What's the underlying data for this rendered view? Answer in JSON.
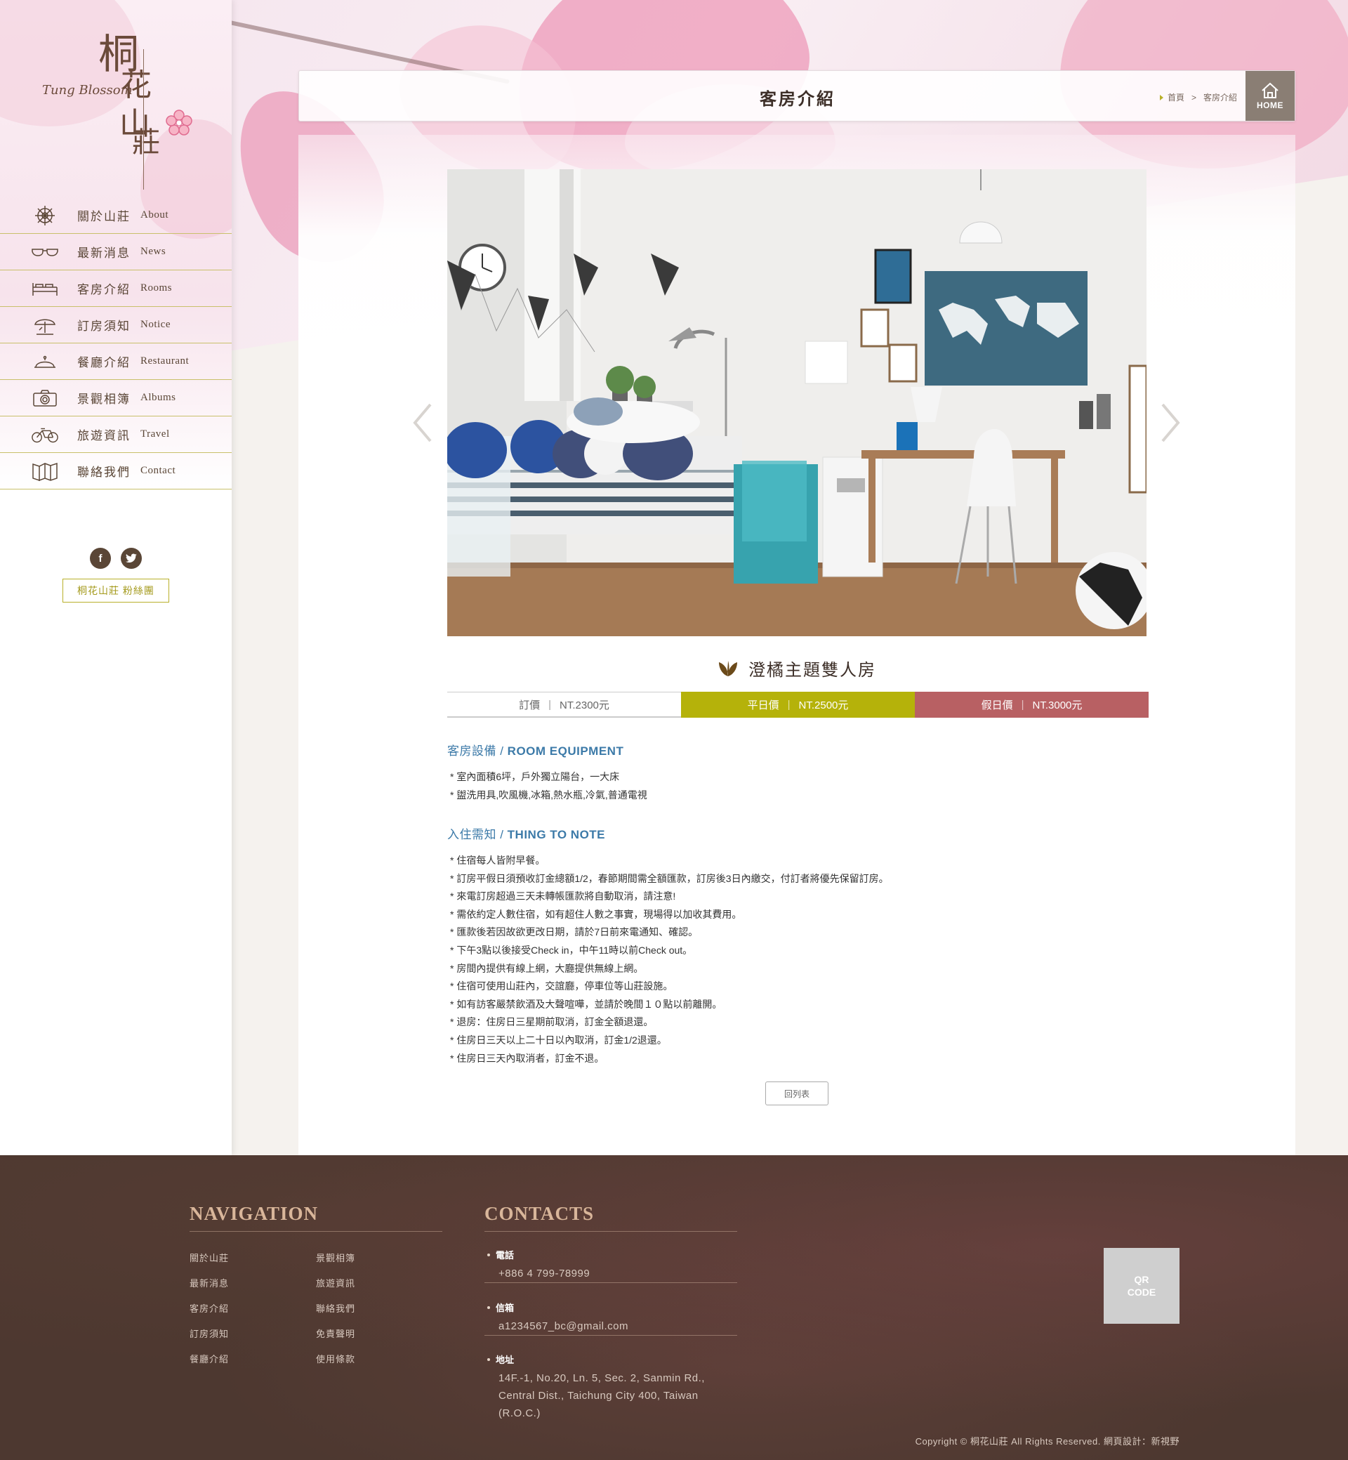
{
  "logo": {
    "zh_chars": [
      "桐",
      "花",
      "山",
      "莊"
    ],
    "en": "Tung Blossom"
  },
  "nav": [
    {
      "zh": "關於山莊",
      "en": "About",
      "icon": "helm-icon"
    },
    {
      "zh": "最新消息",
      "en": "News",
      "icon": "glasses-icon"
    },
    {
      "zh": "客房介紹",
      "en": "Rooms",
      "icon": "bed-icon"
    },
    {
      "zh": "訂房須知",
      "en": "Notice",
      "icon": "beach-umbrella-icon"
    },
    {
      "zh": "餐廳介紹",
      "en": "Restaurant",
      "icon": "dish-cover-icon"
    },
    {
      "zh": "景觀相簿",
      "en": "Albums",
      "icon": "camera-icon"
    },
    {
      "zh": "旅遊資訊",
      "en": "Travel",
      "icon": "bicycle-icon"
    },
    {
      "zh": "聯絡我們",
      "en": "Contact",
      "icon": "map-icon"
    }
  ],
  "social": {
    "facebook": "f",
    "twitter": "t"
  },
  "fans_button": "桐花山莊 粉絲團",
  "header": {
    "title": "客房介紹",
    "breadcrumb": [
      "首頁",
      ">",
      "客房介紹"
    ],
    "home_label": "HOME"
  },
  "room": {
    "name": "澄橘主題雙人房",
    "prices": [
      {
        "label": "訂價",
        "value": "NT.2300元"
      },
      {
        "label": "平日價",
        "value": "NT.2500元"
      },
      {
        "label": "假日價",
        "value": "NT.3000元"
      }
    ]
  },
  "equipment": {
    "title_zh": "客房設備 / ",
    "title_en": "ROOM EQUIPMENT",
    "items": [
      "室內面積6坪，戶外獨立陽台，一大床",
      "盥洗用具,吹風機,冰箱,熱水瓶,冷氣,普通電視"
    ]
  },
  "notes": {
    "title_zh": "入住需知 / ",
    "title_en": "THING TO NOTE",
    "items": [
      "住宿每人皆附早餐。",
      "訂房平假日須預收訂金總額1/2，春節期間需全額匯款，訂房後3日內繳交，付訂者將優先保留訂房。",
      "來電訂房超過三天未轉帳匯款將自動取消，請注意!",
      "需依約定人數住宿，如有超住人數之事實，現場得以加收其費用。",
      "匯款後若因故欲更改日期，請於7日前來電通知、確認。",
      "下午3點以後接受Check in，中午11時以前Check out。",
      "房間內提供有線上網，大廳提供無線上網。",
      "住宿可使用山莊內，交誼廳，停車位等山莊設施。",
      "如有訪客嚴禁飲酒及大聲喧嘩，並請於晚間１０點以前離開。",
      "退房：住房日三星期前取消，訂金全額退還。",
      "住房日三天以上二十日以內取消，訂金1/2退還。",
      "住房日三天內取消者，訂金不退。"
    ]
  },
  "back_button": "回列表",
  "footer": {
    "nav_heading": "NAVIGATION",
    "nav_col1": [
      "關於山莊",
      "最新消息",
      "客房介紹",
      "訂房須知",
      "餐廳介紹"
    ],
    "nav_col2": [
      "景觀相簿",
      "旅遊資訊",
      "聯絡我們",
      "免責聲明",
      "使用條款"
    ],
    "contacts_heading": "CONTACTS",
    "phone_label": "電話",
    "phone": "+886 4 799-78999",
    "email_label": "信箱",
    "email": "a1234567_bc@gmail.com",
    "address_label": "地址",
    "address": [
      "14F.-1, No.20, Ln. 5, Sec. 2, Sanmin Rd.,",
      "Central Dist., Taichung City 400, Taiwan",
      "(R.O.C.)"
    ],
    "qr_text": [
      "QR",
      "CODE"
    ],
    "copyright": "Copyright © 桐花山莊 All Rights Reserved.   網頁設計：新視野"
  },
  "colors": {
    "accent_olive": "#b5b20a",
    "accent_rose": "#b86063",
    "brown": "#5a4636",
    "section_blue": "#3c7aa8"
  }
}
